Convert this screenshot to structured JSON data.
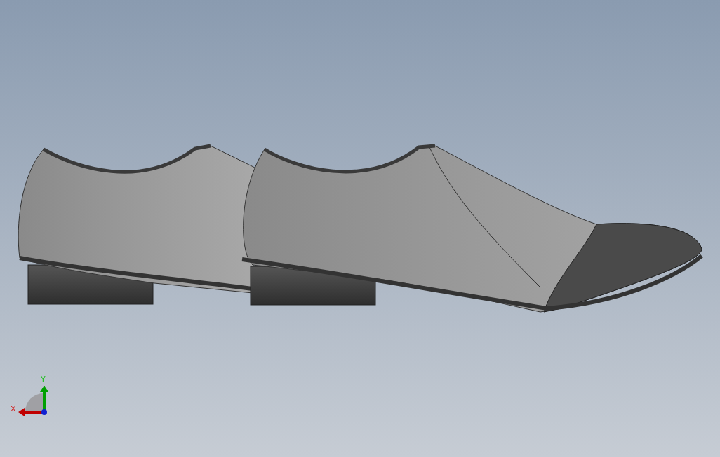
{
  "viewport": {
    "triad": {
      "x_label": "X",
      "y_label": "Y"
    }
  }
}
